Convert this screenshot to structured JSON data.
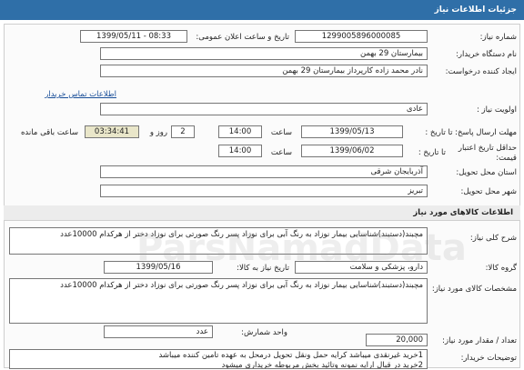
{
  "header": {
    "title": "جزئیات اطلاعات نیاز"
  },
  "need_info": {
    "need_number": {
      "label": "شماره نیاز:",
      "value": "1299005896000085"
    },
    "announce": {
      "label": "تاریخ و ساعت اعلان عمومی:",
      "value": "1399/05/11 - 08:33"
    },
    "buyer_org": {
      "label": "نام دستگاه خریدار:",
      "value": "بیمارستان 29 بهمن"
    },
    "requester": {
      "label": "ایجاد کننده درخواست:",
      "value": "نادر محمد زاده کارپرداز بیمارستان 29 بهمن"
    },
    "contact_link": "اطلاعات تماس خریدار",
    "priority": {
      "label": "اولویت نیاز :",
      "value": "عادی"
    },
    "response_deadline": {
      "label": "مهلت ارسال پاسخ: تا تاریخ :",
      "date": "1399/05/13",
      "time_label": "ساعت",
      "time": "14:00",
      "days": "2",
      "day_label": "روز و",
      "remaining": "03:34:41",
      "remaining_label": "ساعت باقی مانده"
    },
    "price_validity": {
      "label_line1": "حداقل تاریخ اعتبار",
      "label_line2": "قیمت:",
      "to_date_label": "تا تاریخ :",
      "date": "1399/06/02",
      "time_label": "ساعت",
      "time": "14:00"
    },
    "province": {
      "label": "استان محل تحویل:",
      "value": "آذربایجان شرقی"
    },
    "city": {
      "label": "شهر محل تحویل:",
      "value": "تبریز"
    }
  },
  "goods": {
    "title": "اطلاعات کالاهای مورد نیاز",
    "general_desc": {
      "label": "شرح کلی نیاز:",
      "value": "مچبند(دستبند)شناسایی بیمار نوزاد به رنگ آبی برای نوزاد پسر رنگ صورتی برای نوزاد دختر از هرکدام 10000عدد"
    },
    "goods_group": {
      "label": "گروه کالا:",
      "value": "دارو، پزشکی و سلامت"
    },
    "need_date": {
      "label": "تاریخ نیاز به کالا:",
      "value": "1399/05/16"
    },
    "specs": {
      "label": "مشخصات کالای مورد نیاز:",
      "value": "مچبند(دستبند)شناسایی بیمار نوزاد به رنگ آبی برای نوزاد پسر رنگ صورتی برای نوزاد دختر از هرکدام 10000عدد"
    },
    "unit": {
      "label": "واحد شمارش:",
      "value": "عدد"
    },
    "quantity": {
      "label": "تعداد / مقدار مورد نیاز:",
      "value": "20,000"
    },
    "buyer_notes": {
      "label": "توضیحات خریدار:",
      "lines": [
        "1خرید غیرنقدی میباشد کرایه حمل ونقل تحویل درمحل به عهده تامین کننده میباشد",
        "2خرید در قبال ارایه نمونه وتائید بخش مربوطه خریداری میشود"
      ]
    }
  },
  "watermark": "ParsNamadData"
}
